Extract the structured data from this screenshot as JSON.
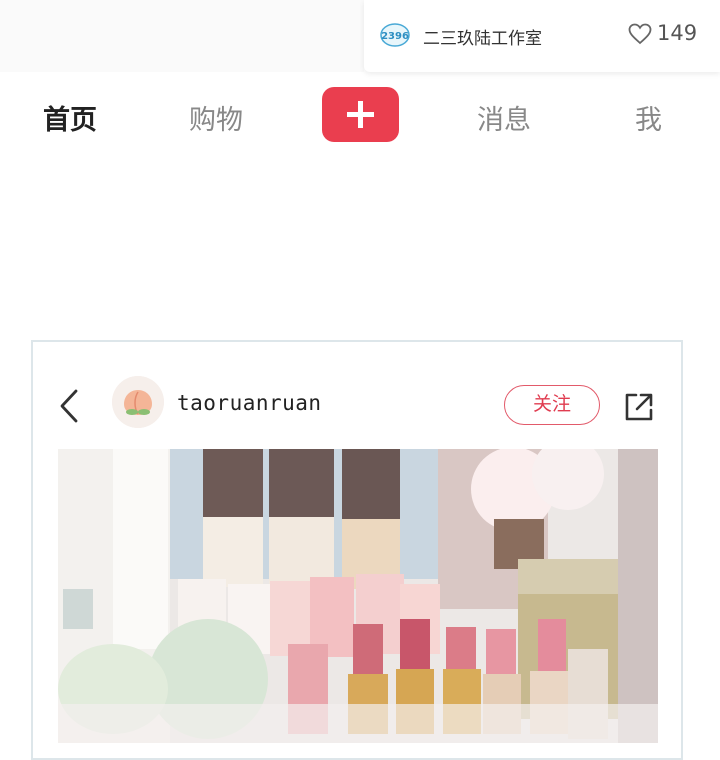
{
  "top_card": {
    "studio_logo_text": "2396",
    "studio_name": "二三玖陆工作室",
    "like_count": "149"
  },
  "nav": {
    "home": "首页",
    "shop": "购物",
    "messages": "消息",
    "me": "我"
  },
  "post": {
    "username": "taoruanruan",
    "follow_label": "关注"
  },
  "colors": {
    "accent": "#ea3e4f",
    "follow_text": "#e03c50",
    "card_border": "#dde6ea"
  },
  "icons": [
    "heart-icon",
    "plus-icon",
    "back-icon",
    "share-icon",
    "peach-avatar"
  ]
}
